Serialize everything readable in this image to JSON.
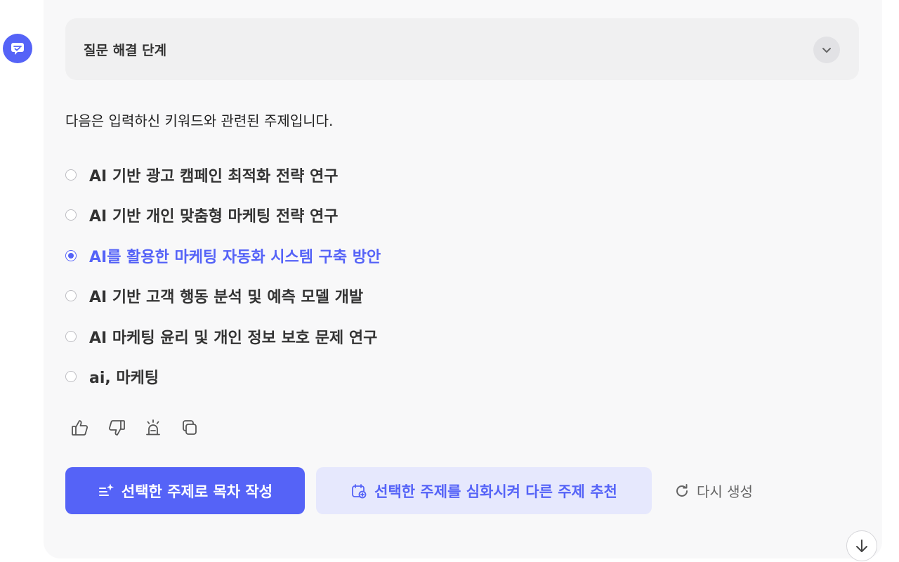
{
  "avatar": {
    "icon": "chat-check-icon",
    "color": "#5563f7"
  },
  "steps": {
    "title": "질문 해결 단계",
    "toggle_icon": "chevron-down-icon"
  },
  "intro": "다음은 입력하신 키워드와 관련된 주제입니다.",
  "topics": [
    {
      "label": "AI 기반 광고 캠페인 최적화 전략 연구",
      "selected": false
    },
    {
      "label": "AI 기반 개인 맞춤형 마케팅 전략 연구",
      "selected": false
    },
    {
      "label": "AI를 활용한 마케팅 자동화 시스템 구축 방안",
      "selected": true
    },
    {
      "label": "AI 기반 고객 행동 분석 및 예측 모델 개발",
      "selected": false
    },
    {
      "label": "AI 마케팅 윤리 및 개인 정보 보호 문제 연구",
      "selected": false
    },
    {
      "label": "ai, 마케팅",
      "selected": false
    }
  ],
  "feedback": [
    "thumbs-up-icon",
    "thumbs-down-icon",
    "siren-icon",
    "copy-icon"
  ],
  "actions": {
    "primary_label": "선택한 주제로 목차 작성",
    "secondary_label": "선택한 주제를 심화시켜 다른 주제 추천",
    "regenerate_label": "다시 생성"
  },
  "colors": {
    "accent": "#5563f7",
    "accent_light": "#e6e8fd",
    "card_bg": "#f8f8f9"
  }
}
